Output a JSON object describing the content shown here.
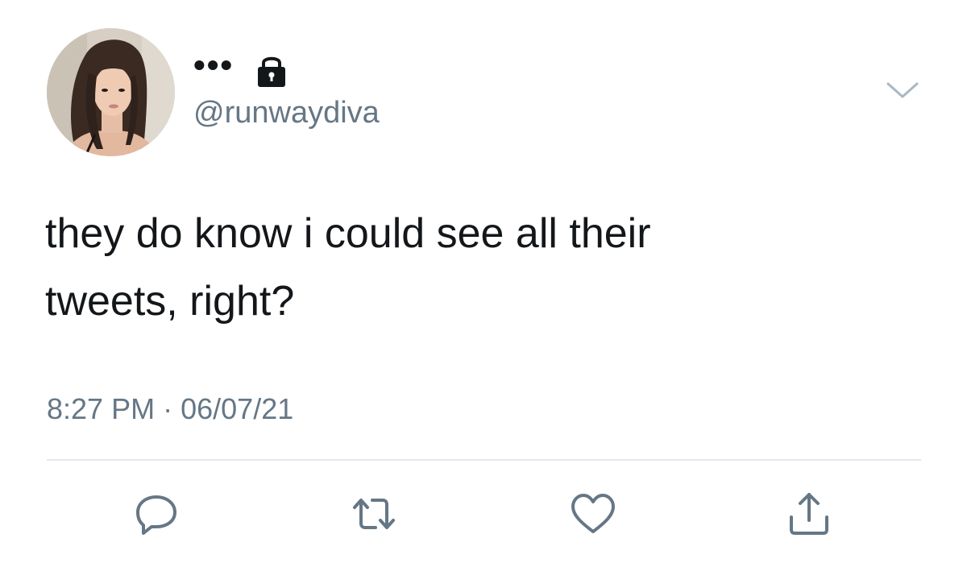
{
  "tweet": {
    "display_name": "•••",
    "locked": true,
    "handle": "@runwaydiva",
    "text_line1": "they do know i could see all their",
    "text_line2": "tweets, right?",
    "time": "8:27 PM",
    "separator": "·",
    "date": "06/07/21"
  },
  "icons": {
    "lock": "lock-icon",
    "caret": "chevron-down-icon",
    "reply": "reply-icon",
    "retweet": "retweet-icon",
    "like": "heart-icon",
    "share": "share-icon"
  },
  "colors": {
    "text": "#14171a",
    "secondary": "#657786",
    "divider": "#e1e8ed",
    "caret": "#aab8c2"
  }
}
